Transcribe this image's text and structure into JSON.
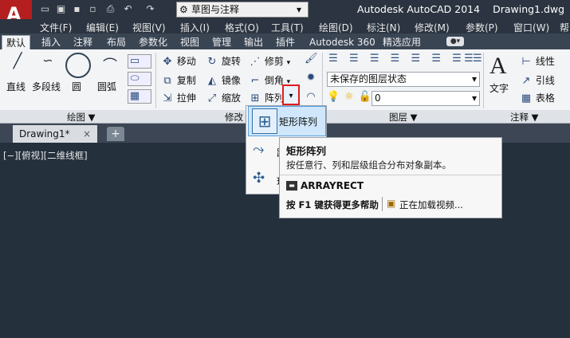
{
  "app": {
    "title": "Autodesk AutoCAD 2014",
    "filename": "Drawing1.dwg",
    "workspace": "草图与注释"
  },
  "quick_access": {
    "icons": [
      "new-file-icon",
      "open-folder-icon",
      "save-icon",
      "save-as-icon",
      "print-icon",
      "undo-icon",
      "redo-icon",
      "gear-icon"
    ]
  },
  "menu": {
    "items": [
      "文件(F)",
      "编辑(E)",
      "视图(V)",
      "插入(I)",
      "格式(O)",
      "工具(T)",
      "绘图(D)",
      "标注(N)",
      "修改(M)",
      "参数(P)",
      "窗口(W)",
      "帮"
    ]
  },
  "ribbon_tabs": {
    "items": [
      "默认",
      "插入",
      "注释",
      "布局",
      "参数化",
      "视图",
      "管理",
      "输出",
      "插件",
      "Autodesk 360",
      "精选应用"
    ],
    "active": "默认"
  },
  "draw_panel": {
    "tools": [
      "直线",
      "多段线",
      "圆",
      "圆弧"
    ],
    "title": "绘图 ▼"
  },
  "modify_panel": {
    "row1": [
      "移动",
      "旋转",
      "修剪"
    ],
    "row2": [
      "复制",
      "镜像",
      "倒角"
    ],
    "row3": [
      "拉伸",
      "缩放",
      "阵列"
    ],
    "title": "修改"
  },
  "layer_panel": {
    "state": "未保存的图层状态",
    "layer_value": "0",
    "title": "图层 ▼"
  },
  "annotation_panel": {
    "text_label": "文字",
    "row1": "线性",
    "row2": "引线",
    "row3": "表格",
    "title": "注释 ▼"
  },
  "document_tabs": {
    "name": "Drawing1*"
  },
  "viewport": {
    "label": "[−][俯视][二维线框]"
  },
  "array_dropdown": {
    "item1": "矩形阵列",
    "item2": "路",
    "item3": "环"
  },
  "tooltip": {
    "title": "矩形阵列",
    "description": "按任意行、列和层级组合分布对象副本。",
    "command": "ARRAYRECT",
    "help": "按 F1 键获得更多帮助",
    "video": "正在加载视频..."
  },
  "colors": {
    "ribbon_bg": "#f3f4f6",
    "title_bg": "#2b3440",
    "viewport_bg": "#25303d",
    "logo_red": "#b51e1e",
    "highlight": "#cfe6fb"
  }
}
